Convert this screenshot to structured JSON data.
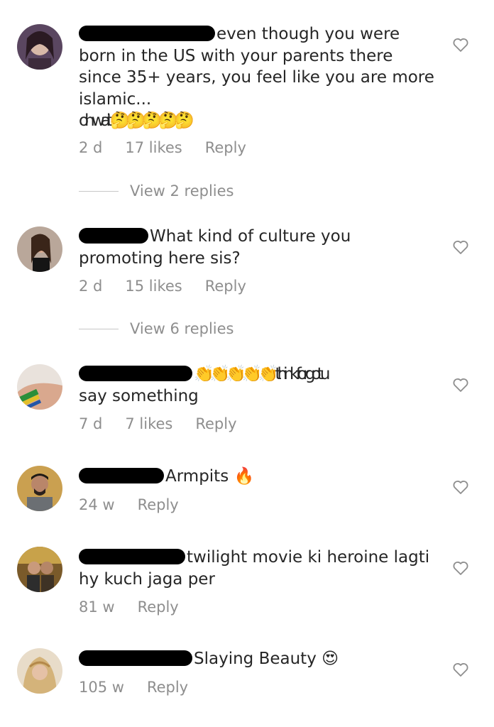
{
  "comments": [
    {
      "lines": [
        "even though you were",
        "born in the US with your parents there",
        "since 35+ years, you feel like you are more",
        "islamic...",
        "oh wait 🤔🤔🤔🤔🤔"
      ],
      "time": "2 d",
      "likes": "17 likes",
      "reply": "Reply",
      "view_replies": "View 2 replies"
    },
    {
      "lines": [
        "What kind of culture you",
        "promoting here sis?"
      ],
      "time": "2 d",
      "likes": "15 likes",
      "reply": "Reply",
      "view_replies": "View 6 replies"
    },
    {
      "lines": [
        "👏👏👏👏👏 think forgot u",
        "say something"
      ],
      "time": "7 d",
      "likes": "7 likes",
      "reply": "Reply"
    },
    {
      "lines": [
        "Armpits 🔥"
      ],
      "time": "24 w",
      "reply": "Reply"
    },
    {
      "lines": [
        "twilight movie ki heroine lagti",
        "hy kuch jaga per"
      ],
      "time": "81 w",
      "reply": "Reply"
    },
    {
      "lines": [
        "Slaying Beauty 😍"
      ],
      "time": "105 w",
      "reply": "Reply"
    }
  ],
  "icons": {
    "like": "heart-outline-icon"
  },
  "colors": {
    "text": "#262626",
    "meta": "#8e8e8e",
    "redaction": "#000000"
  }
}
